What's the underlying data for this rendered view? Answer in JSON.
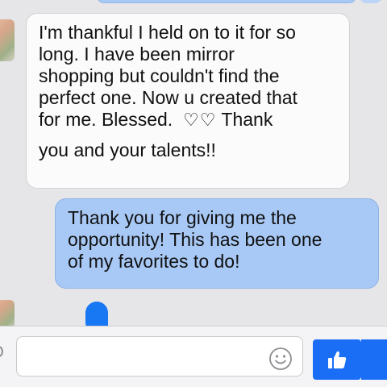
{
  "thread": {
    "incoming": {
      "lines": [
        "I'm thankful I held on to it for so",
        "long. I have been mirror",
        "shopping but couldn't find the",
        "perfect one. Now u created that",
        "for me. Blessed.",
        "you and your talents!!"
      ],
      "hearts": "♡♡",
      "after_hearts": "Thank"
    },
    "outgoing": {
      "lines": [
        "Thank you for giving me the",
        "opportunity! This has been one",
        "of my favorites to do!"
      ]
    }
  },
  "composer": {
    "placeholder": "",
    "emoji_icon": "smiley-face-icon",
    "like_icon": "thumbs-up-icon"
  },
  "colors": {
    "incoming_bubble": "#fbfbfb",
    "outgoing_bubble": "#a8c9f6",
    "like_button": "#1a6ef5",
    "background": "#e6e6e8"
  }
}
